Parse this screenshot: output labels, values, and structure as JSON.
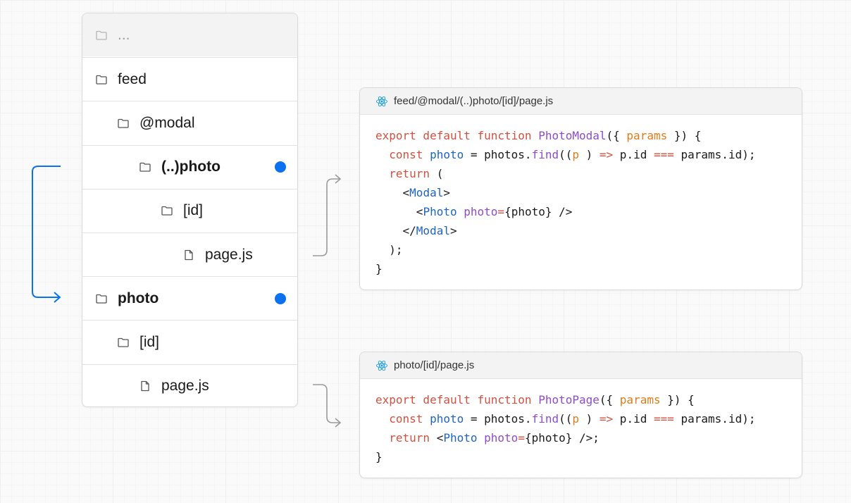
{
  "tree": {
    "rows": [
      {
        "label": "...",
        "indent": 0,
        "type": "folder",
        "bold": false,
        "dot": false
      },
      {
        "label": "feed",
        "indent": 0,
        "type": "folder",
        "bold": false,
        "dot": false
      },
      {
        "label": "@modal",
        "indent": 1,
        "type": "folder",
        "bold": false,
        "dot": false
      },
      {
        "label": "(..)photo",
        "indent": 2,
        "type": "folder",
        "bold": true,
        "dot": true
      },
      {
        "label": "[id]",
        "indent": 3,
        "type": "folder",
        "bold": false,
        "dot": false
      },
      {
        "label": "page.js",
        "indent": 4,
        "type": "file",
        "bold": false,
        "dot": false
      },
      {
        "label": "photo",
        "indent": 0,
        "type": "folder",
        "bold": true,
        "dot": true
      },
      {
        "label": "[id]",
        "indent": 1,
        "type": "folder",
        "bold": false,
        "dot": false
      },
      {
        "label": "page.js",
        "indent": 2,
        "type": "file",
        "bold": false,
        "dot": false
      }
    ]
  },
  "cards": [
    {
      "filename": "feed/@modal/(..)photo/[id]/page.js",
      "icon": "react-icon",
      "lines": [
        [
          [
            "kw",
            "export default function "
          ],
          [
            "fn",
            "PhotoModal"
          ],
          [
            "",
            "({ "
          ],
          [
            "par",
            "params"
          ],
          [
            "",
            " }) {"
          ]
        ],
        [
          [
            "",
            "  "
          ],
          [
            "kw",
            "const "
          ],
          [
            "var",
            "photo"
          ],
          [
            "",
            " = photos."
          ],
          [
            "fn",
            "find"
          ],
          [
            "",
            "(("
          ],
          [
            "par",
            "p"
          ],
          [
            "",
            " ) "
          ],
          [
            "kw",
            "=>"
          ],
          [
            "",
            " p.id "
          ],
          [
            "kw",
            "==="
          ],
          [
            "",
            " params.id);"
          ]
        ],
        [
          [
            "",
            "  "
          ],
          [
            "kw",
            "return"
          ],
          [
            "",
            " ("
          ]
        ],
        [
          [
            "",
            "    <"
          ],
          [
            "tag",
            "Modal"
          ],
          [
            "",
            ">"
          ]
        ],
        [
          [
            "",
            "      <"
          ],
          [
            "tag",
            "Photo"
          ],
          [
            "",
            " "
          ],
          [
            "fn",
            "photo"
          ],
          [
            "kw",
            "="
          ],
          [
            "",
            "{photo} />"
          ]
        ],
        [
          [
            "",
            "    </"
          ],
          [
            "tag",
            "Modal"
          ],
          [
            "",
            ">"
          ]
        ],
        [
          [
            "",
            "  );"
          ]
        ],
        [
          [
            "",
            "}"
          ]
        ]
      ]
    },
    {
      "filename": "photo/[id]/page.js",
      "icon": "react-icon",
      "lines": [
        [
          [
            "kw",
            "export default function "
          ],
          [
            "fn",
            "PhotoPage"
          ],
          [
            "",
            "({ "
          ],
          [
            "par",
            "params"
          ],
          [
            "",
            " }) {"
          ]
        ],
        [
          [
            "",
            "  "
          ],
          [
            "kw",
            "const "
          ],
          [
            "var",
            "photo"
          ],
          [
            "",
            " = photos."
          ],
          [
            "fn",
            "find"
          ],
          [
            "",
            "(("
          ],
          [
            "par",
            "p"
          ],
          [
            "",
            " ) "
          ],
          [
            "kw",
            "=>"
          ],
          [
            "",
            " p.id "
          ],
          [
            "kw",
            "==="
          ],
          [
            "",
            " params.id);"
          ]
        ],
        [
          [
            "",
            "  "
          ],
          [
            "kw",
            "return"
          ],
          [
            "",
            " <"
          ],
          [
            "tag",
            "Photo"
          ],
          [
            "",
            " "
          ],
          [
            "fn",
            "photo"
          ],
          [
            "kw",
            "="
          ],
          [
            "",
            "{photo} />;"
          ]
        ],
        [
          [
            "",
            "}"
          ]
        ]
      ]
    }
  ],
  "colors": {
    "accent": "#0a72ef",
    "connector": "#9a9a9a",
    "keyword": "#d4503f",
    "function": "#8f4bc8",
    "param": "#e07c19",
    "tag": "#1d64c6"
  }
}
